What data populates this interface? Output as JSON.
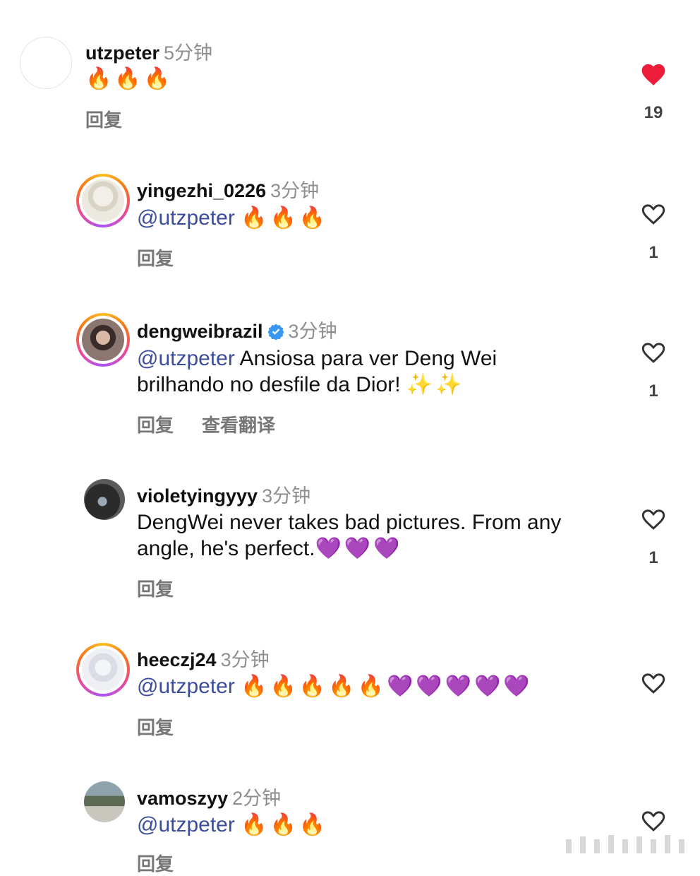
{
  "comments": [
    {
      "username": "utzpeter",
      "time": "5分钟",
      "mention": "",
      "text": "",
      "emoji": "🔥🔥🔥",
      "reply_label": "回复",
      "translate_label": "",
      "likes": "19",
      "liked": true
    },
    {
      "username": "yingezhi_0226",
      "time": "3分钟",
      "mention": "@utzpeter",
      "text": "",
      "emoji": "🔥🔥🔥",
      "reply_label": "回复",
      "translate_label": "",
      "likes": "1",
      "liked": false
    },
    {
      "username": "dengweibrazil",
      "time": "3分钟",
      "mention": "@utzpeter",
      "text": "Ansiosa para ver Deng Wei",
      "text2": "brilhando no desfile da Dior!",
      "emoji": "✨✨",
      "reply_label": "回复",
      "translate_label": "查看翻译",
      "likes": "1",
      "liked": false,
      "verified": true
    },
    {
      "username": "violetyingyyy",
      "time": "3分钟",
      "mention": "",
      "text": "DengWei never takes bad pictures. From any",
      "text2": "angle, he's perfect.",
      "emoji": "💜💜💜",
      "reply_label": "回复",
      "translate_label": "",
      "likes": "1",
      "liked": false
    },
    {
      "username": "heeczj24",
      "time": "3分钟",
      "mention": "@utzpeter",
      "text": "",
      "emoji": "🔥🔥🔥🔥🔥💜💜💜💜💜",
      "reply_label": "回复",
      "translate_label": "",
      "likes": "",
      "liked": false
    },
    {
      "username": "vamoszyy",
      "time": "2分钟",
      "mention": "@utzpeter",
      "text": "",
      "emoji": "🔥🔥🔥",
      "reply_label": "回复",
      "translate_label": "",
      "likes": "",
      "liked": false
    }
  ],
  "colors": {
    "like_red": "#ed1c3a",
    "mention_blue": "#3b4d9b",
    "verified_blue": "#3897f0"
  },
  "icons": {
    "like": "heart-icon",
    "liked": "heart-filled-icon",
    "verified": "verified-badge-icon"
  }
}
